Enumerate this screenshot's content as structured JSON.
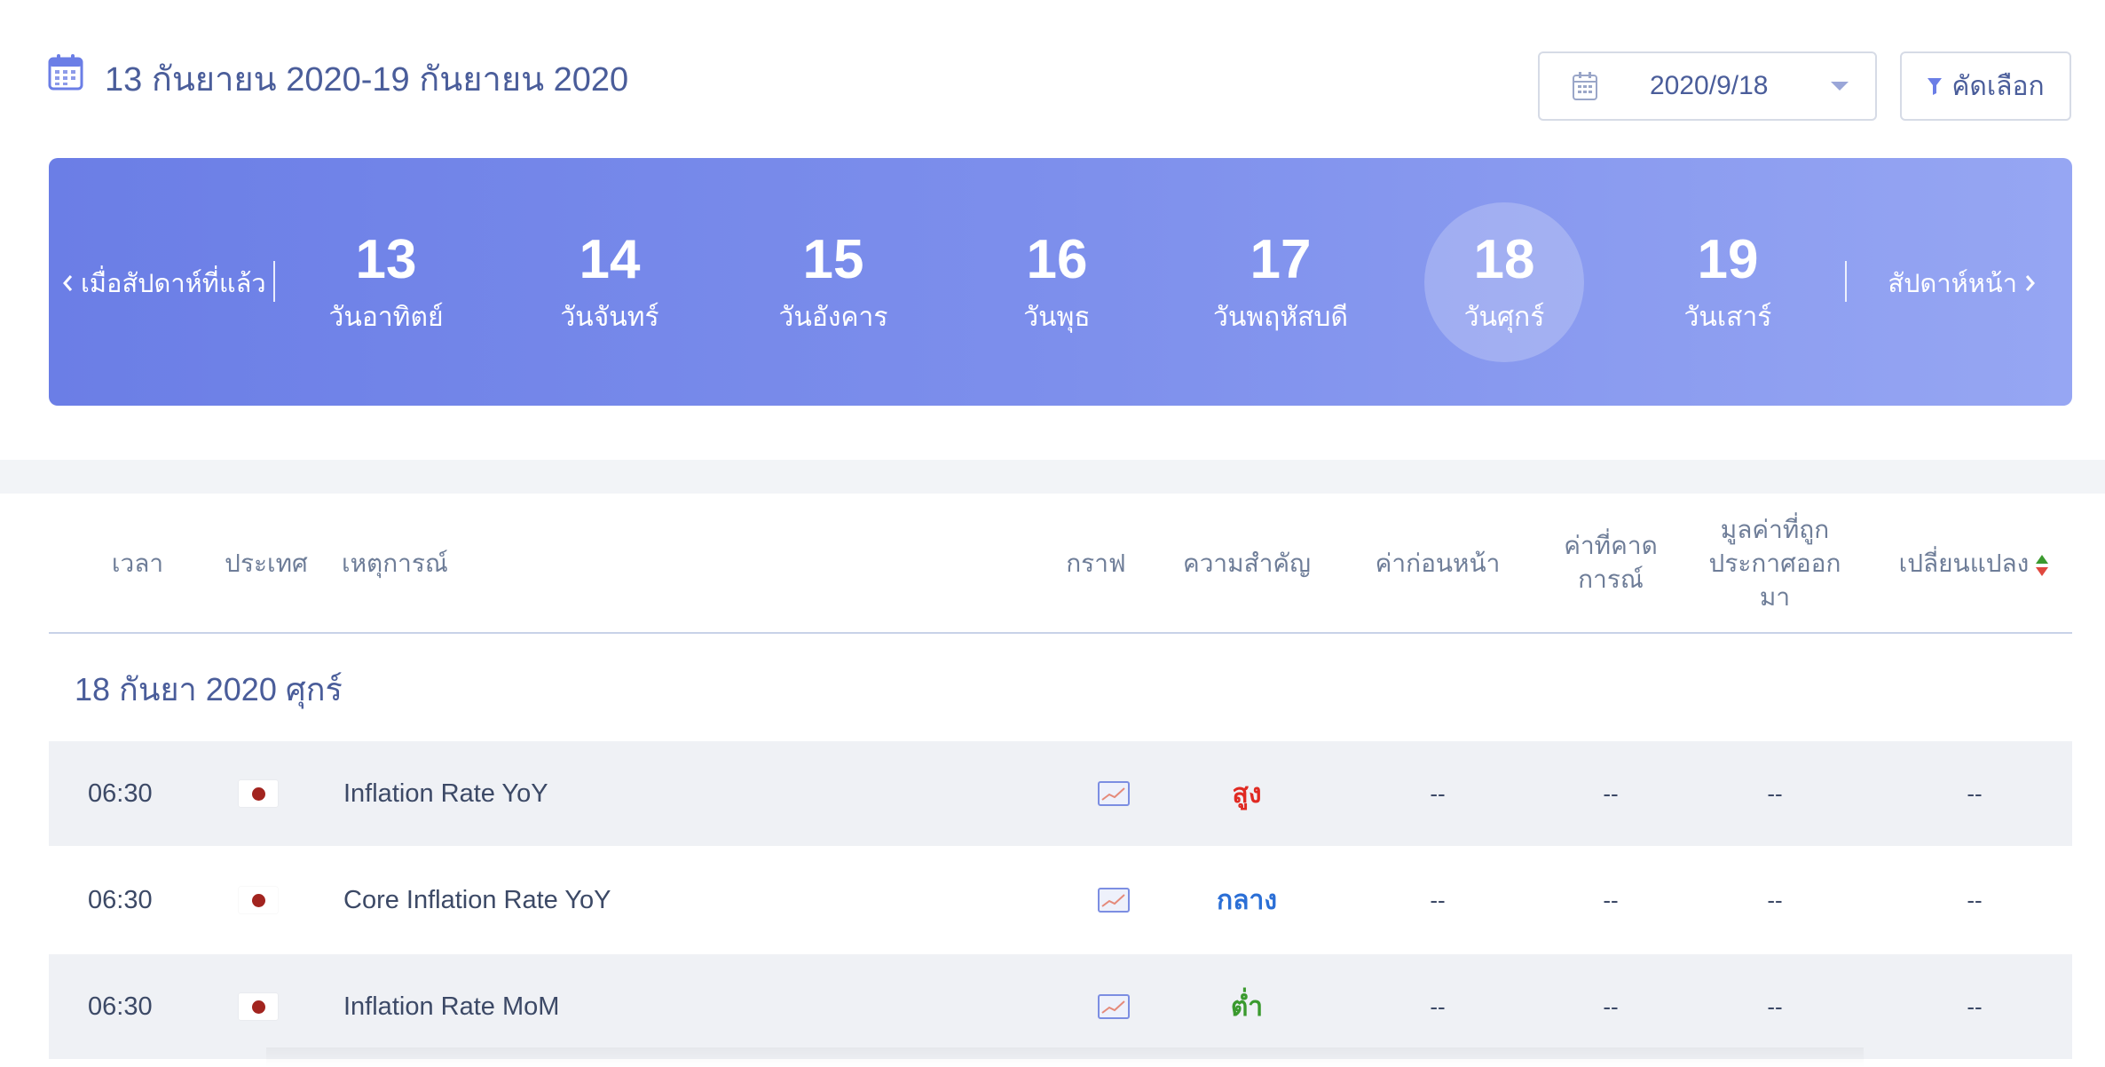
{
  "header": {
    "range_title": "13 กันยายน 2020-19 กันยายน 2020",
    "date_value": "2020/9/18",
    "filter_label": "คัดเลือก"
  },
  "week": {
    "prev_label": "เมื่อสัปดาห์ที่แล้ว",
    "next_label": "สัปดาห์หน้า",
    "days": [
      {
        "num": "13",
        "name": "วันอาทิตย์",
        "selected": false
      },
      {
        "num": "14",
        "name": "วันจันทร์",
        "selected": false
      },
      {
        "num": "15",
        "name": "วันอังคาร",
        "selected": false
      },
      {
        "num": "16",
        "name": "วันพุธ",
        "selected": false
      },
      {
        "num": "17",
        "name": "วันพฤหัสบดี",
        "selected": false
      },
      {
        "num": "18",
        "name": "วันศุกร์",
        "selected": true
      },
      {
        "num": "19",
        "name": "วันเสาร์",
        "selected": false
      }
    ]
  },
  "table": {
    "columns": {
      "time": "เวลา",
      "country": "ประเทศ",
      "event": "เหตุการณ์",
      "chart": "กราฟ",
      "importance": "ความสำคัญ",
      "previous": "ค่าก่อนหน้า",
      "forecast_l1": "ค่าที่คาด",
      "forecast_l2": "การณ์",
      "actual_l1": "มูลค่าที่ถูก",
      "actual_l2": "ประกาศออก",
      "actual_l3": "มา",
      "change": "เปลี่ยนแปลง"
    },
    "date_heading": "18 กันยา 2020 ศุกร์",
    "rows": [
      {
        "time": "06:30",
        "country_icon": "japan-flag",
        "event": "Inflation Rate YoY",
        "importance": "สูง",
        "importance_color": "#e02a22",
        "previous": "--",
        "forecast": "--",
        "actual": "--",
        "change": "--"
      },
      {
        "time": "06:30",
        "country_icon": "japan-flag",
        "event": "Core Inflation Rate YoY",
        "importance": "กลาง",
        "importance_color": "#2b6fd6",
        "previous": "--",
        "forecast": "--",
        "actual": "--",
        "change": "--"
      },
      {
        "time": "06:30",
        "country_icon": "japan-flag",
        "event": "Inflation Rate MoM",
        "importance": "ต่ำ",
        "importance_color": "#3a9a2e",
        "previous": "--",
        "forecast": "--",
        "actual": "--",
        "change": "--"
      }
    ]
  },
  "colors": {
    "band_start": "#6b7ee6",
    "band_end": "#96a6f3",
    "title_text": "#4a5d9a"
  }
}
